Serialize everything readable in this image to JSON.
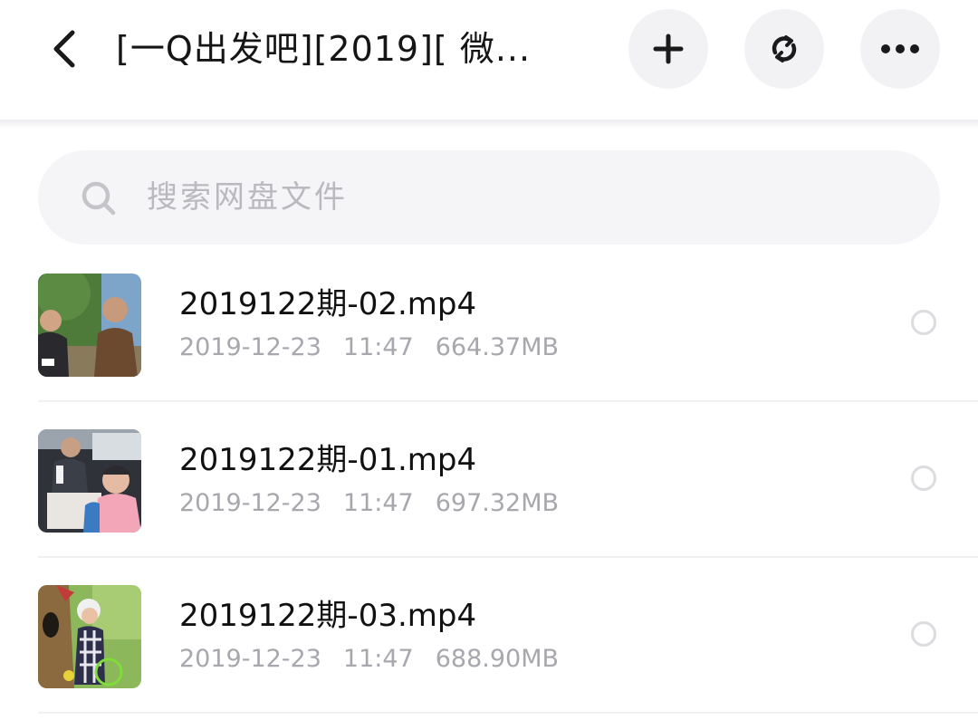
{
  "header": {
    "title": "[一Q出发吧][2019][ 微...",
    "back_icon": "chevron-left-icon",
    "add_icon": "plus-icon",
    "refresh_icon": "refresh-icon",
    "more_icon": "more-horizontal-icon",
    "button_bg": "#f2f2f4"
  },
  "search": {
    "placeholder": "搜索网盘文件",
    "icon": "search-icon"
  },
  "files": [
    {
      "name": "2019122期-02.mp4",
      "date": "2019-12-23",
      "time": "11:47",
      "size": "664.37MB",
      "thumb": "outdoor-men-thumbnail"
    },
    {
      "name": "2019122期-01.mp4",
      "date": "2019-12-23",
      "time": "11:47",
      "size": "697.32MB",
      "thumb": "car-interior-thumbnail"
    },
    {
      "name": "2019122期-03.mp4",
      "date": "2019-12-23",
      "time": "11:47",
      "size": "688.90MB",
      "thumb": "child-meadow-thumbnail"
    }
  ],
  "colors": {
    "meta_text": "#a7a7ad",
    "placeholder_text": "#b9b9bf",
    "radio_border": "#dcdce0"
  }
}
